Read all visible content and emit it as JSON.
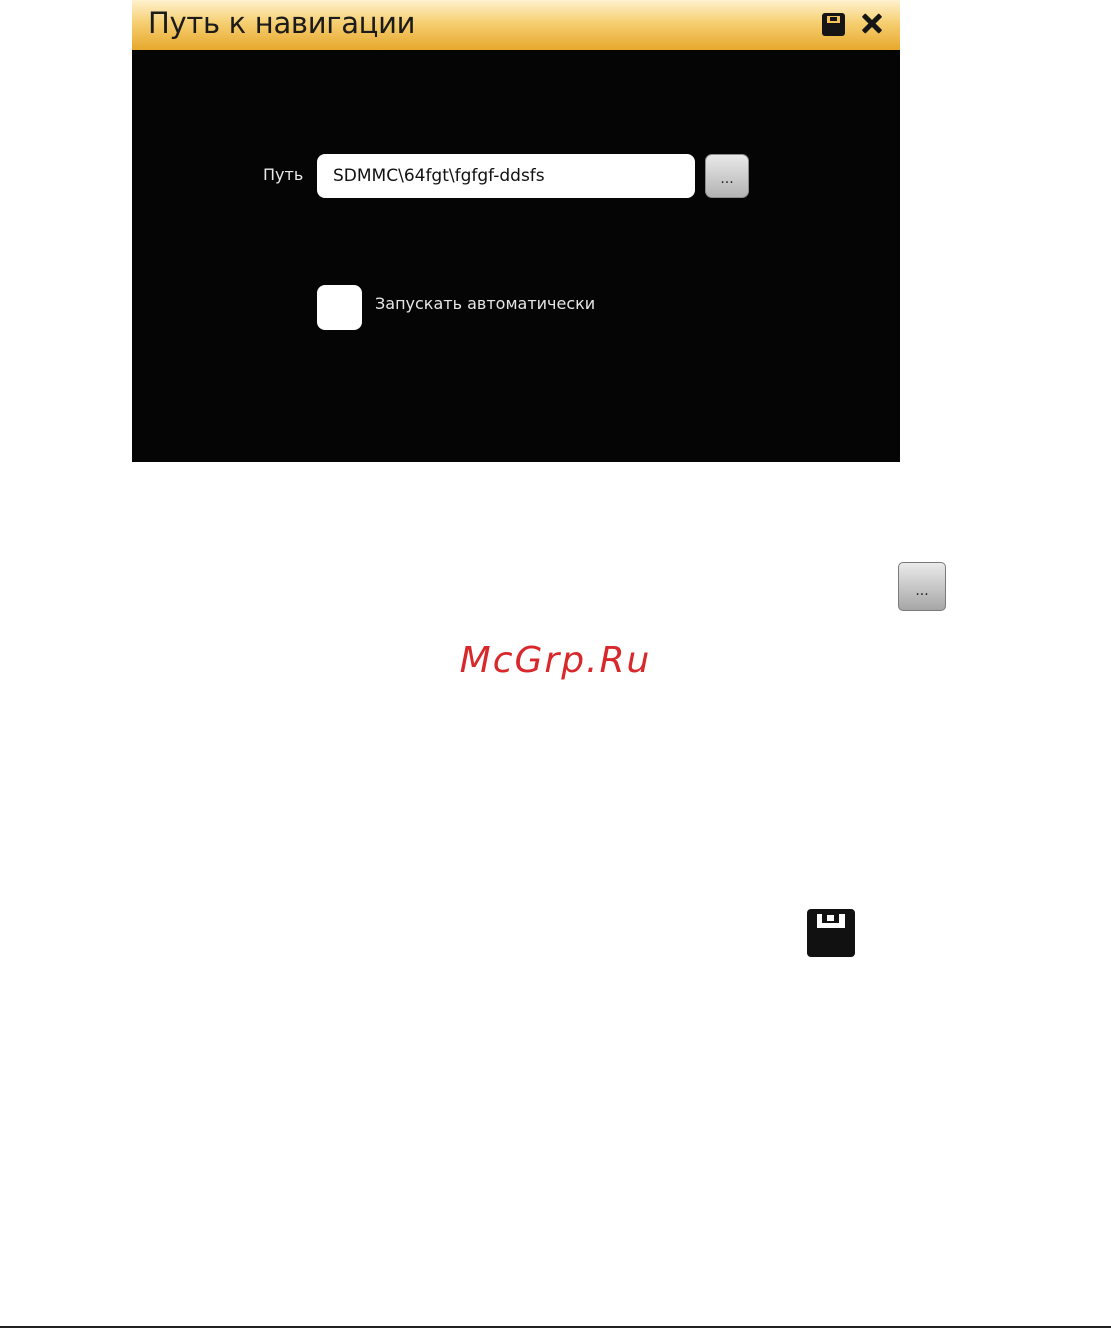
{
  "dialog": {
    "title": "Путь к навигации",
    "path_label": "Путь",
    "path_value": "SDMMC\\64fgt\\fgfgf-ddsfs",
    "browse_label": "...",
    "autostart_label": "Запускать автоматически",
    "autostart_checked": false
  },
  "icons": {
    "save": "floppy-disk-icon",
    "close": "close-icon"
  },
  "manual": {
    "browse_label": "...",
    "watermark": "McGrp.Ru"
  },
  "colors": {
    "titlebar_accent": "#f6cf72",
    "dialog_bg": "#050505",
    "watermark": "#d9282c"
  }
}
